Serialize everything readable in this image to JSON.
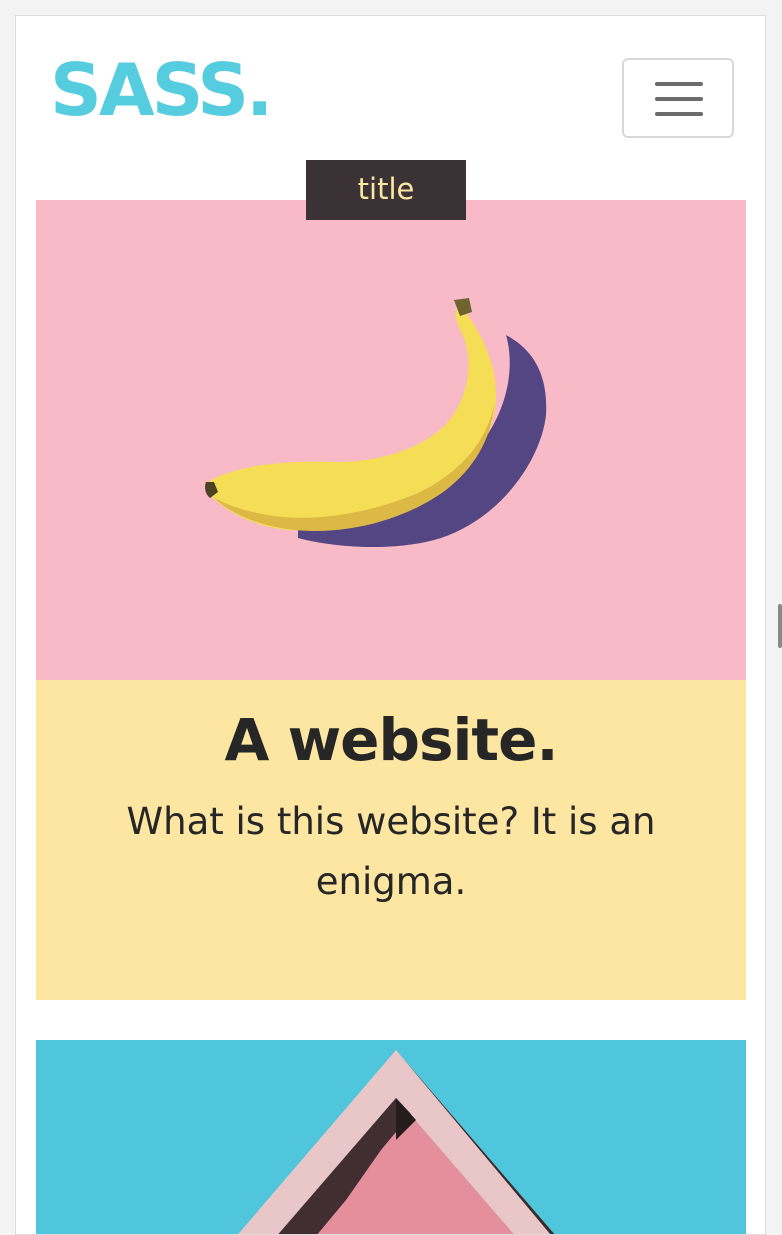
{
  "header": {
    "logo": "SASS.",
    "menu_icon": "hamburger-icon"
  },
  "cards": [
    {
      "tag": "title",
      "image": "banana-photo",
      "heading": "A website.",
      "text": "What is this website? It is an enigma."
    },
    {
      "image": "house-roof-photo"
    }
  ],
  "colors": {
    "logo": "#56cddf",
    "banana_background": "#f7bac6",
    "caption_background": "#fce6a1",
    "tag_background": "#3a3234",
    "tag_text": "#fbe6a2",
    "house_background": "#4fc6dc"
  }
}
